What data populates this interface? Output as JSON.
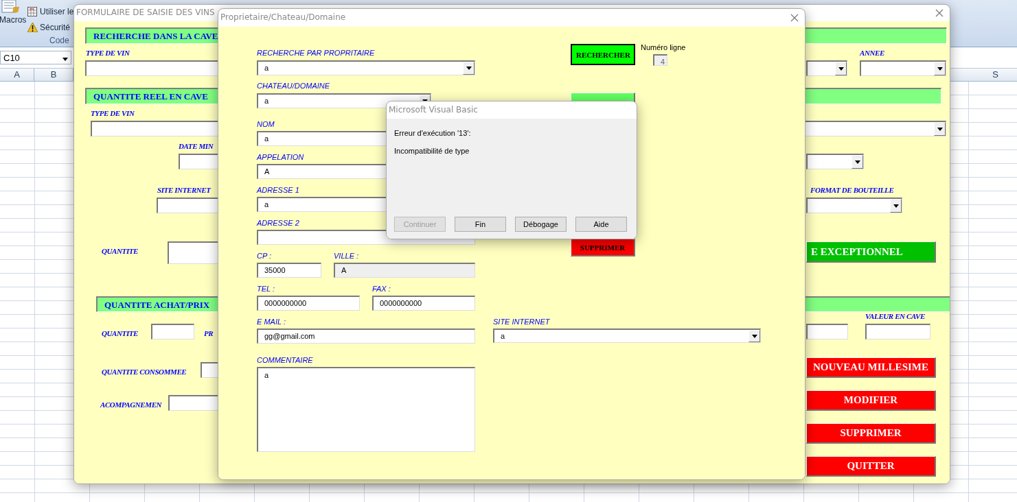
{
  "excel": {
    "ribbon": {
      "macros_label": "Macros",
      "items": [
        "Utiliser le",
        "Sécurité"
      ],
      "group_label": "Code"
    },
    "name_box": "C10",
    "columns": [
      "A",
      "B",
      "S"
    ]
  },
  "main_form": {
    "title": "FORMULAIRE DE SAISIE DES VINS",
    "controls": [
      {
        "kind": "section",
        "text": "RECHERCHE DANS LA CAVE"
      },
      {
        "kind": "label",
        "text": "TYPE DE VIN"
      },
      {
        "kind": "field"
      },
      {
        "kind": "combo"
      },
      {
        "kind": "label",
        "text": "ANNEE"
      },
      {
        "kind": "combo"
      },
      {
        "kind": "section",
        "text": "QUANTITE REEL EN CAVE"
      },
      {
        "kind": "label",
        "text": "TYPE DE VIN"
      },
      {
        "kind": "combo"
      },
      {
        "kind": "label",
        "text": "DATE MIN"
      },
      {
        "kind": "field"
      },
      {
        "kind": "combo"
      },
      {
        "kind": "label",
        "text": "SITE INTERNET"
      },
      {
        "kind": "label",
        "text": "FORMAT DE BOUTEILLE"
      },
      {
        "kind": "field"
      },
      {
        "kind": "combo"
      },
      {
        "kind": "label",
        "text": "QUANTITE"
      },
      {
        "kind": "field"
      },
      {
        "kind": "button",
        "text": "E EXCEPTIONNEL",
        "color": "#00c000"
      },
      {
        "kind": "section",
        "text": "QUANTITE ACHAT/PRIX"
      },
      {
        "kind": "label",
        "text": "QUANTITE"
      },
      {
        "kind": "field"
      },
      {
        "kind": "label",
        "text": "PR"
      },
      {
        "kind": "label",
        "text": "VALEUR EN CAVE"
      },
      {
        "kind": "field"
      },
      {
        "kind": "field"
      },
      {
        "kind": "label",
        "text": "QUANTITE CONSOMMEE"
      },
      {
        "kind": "field"
      },
      {
        "kind": "button",
        "text": "NOUVEAU MILLESIME",
        "color": "#ff0000"
      },
      {
        "kind": "label",
        "text": "ACOMPAGNEMEN"
      },
      {
        "kind": "field"
      },
      {
        "kind": "button",
        "text": "MODIFIER",
        "color": "#ff0000"
      },
      {
        "kind": "button",
        "text": "SUPPRIMER",
        "color": "#ff0000"
      },
      {
        "kind": "button",
        "text": "QUITTER",
        "color": "#ff0000"
      }
    ]
  },
  "owner_form": {
    "title": "Proprietaire/Chateau/Domaine",
    "controls": [
      {
        "kind": "label",
        "text": "RECHERCHE PAR PROPRITAIRE"
      },
      {
        "kind": "combo",
        "value": "a",
        "disabled": false
      },
      {
        "kind": "button",
        "text": "RECHERCHER",
        "color": "#00ff00"
      },
      {
        "kind": "caption",
        "text": "Numéro ligne"
      },
      {
        "kind": "field",
        "value": "4",
        "disabled": true
      },
      {
        "kind": "label",
        "text": "CHATEAU/DOMAINE"
      },
      {
        "kind": "combo",
        "value": "a",
        "disabled": false
      },
      {
        "kind": "button",
        "color": "#60ff60"
      },
      {
        "kind": "label",
        "text": "NOM"
      },
      {
        "kind": "field",
        "value": "a",
        "disabled": false
      },
      {
        "kind": "label",
        "text": "APPELATION"
      },
      {
        "kind": "field",
        "value": "A",
        "disabled": false
      },
      {
        "kind": "label",
        "text": "ADRESSE 1"
      },
      {
        "kind": "field",
        "value": "a",
        "disabled": false
      },
      {
        "kind": "label",
        "text": "ADRESSE 2"
      },
      {
        "kind": "field",
        "disabled": false
      },
      {
        "kind": "button",
        "text": "SUPPRIMER",
        "color": "#ff0000"
      },
      {
        "kind": "label",
        "text": "CP :"
      },
      {
        "kind": "label",
        "text": "VILLE :"
      },
      {
        "kind": "field",
        "value": "35000",
        "disabled": false
      },
      {
        "kind": "field",
        "value": "A",
        "disabled": true
      },
      {
        "kind": "label",
        "text": "TEL :"
      },
      {
        "kind": "label",
        "text": "FAX :"
      },
      {
        "kind": "field",
        "value": "0000000000",
        "disabled": false
      },
      {
        "kind": "field",
        "value": "0000000000",
        "disabled": false
      },
      {
        "kind": "label",
        "text": "E MAIL :"
      },
      {
        "kind": "label",
        "text": "SITE INTERNET"
      },
      {
        "kind": "field",
        "value": "gg@gmail.com",
        "disabled": false
      },
      {
        "kind": "combo",
        "value": "a",
        "disabled": false
      },
      {
        "kind": "label",
        "text": "COMMENTAIRE"
      },
      {
        "kind": "textarea",
        "value": "a",
        "disabled": false
      }
    ]
  },
  "msgbox": {
    "title": "Microsoft Visual Basic",
    "lines": [
      "Erreur d'exécution '13':",
      "Incompatibilité de type"
    ],
    "buttons": [
      {
        "label": "Continuer",
        "disabled": true
      },
      {
        "label": "Fin",
        "disabled": false
      },
      {
        "label": "Débogage",
        "disabled": false
      },
      {
        "label": "Aide",
        "disabled": false
      }
    ]
  }
}
